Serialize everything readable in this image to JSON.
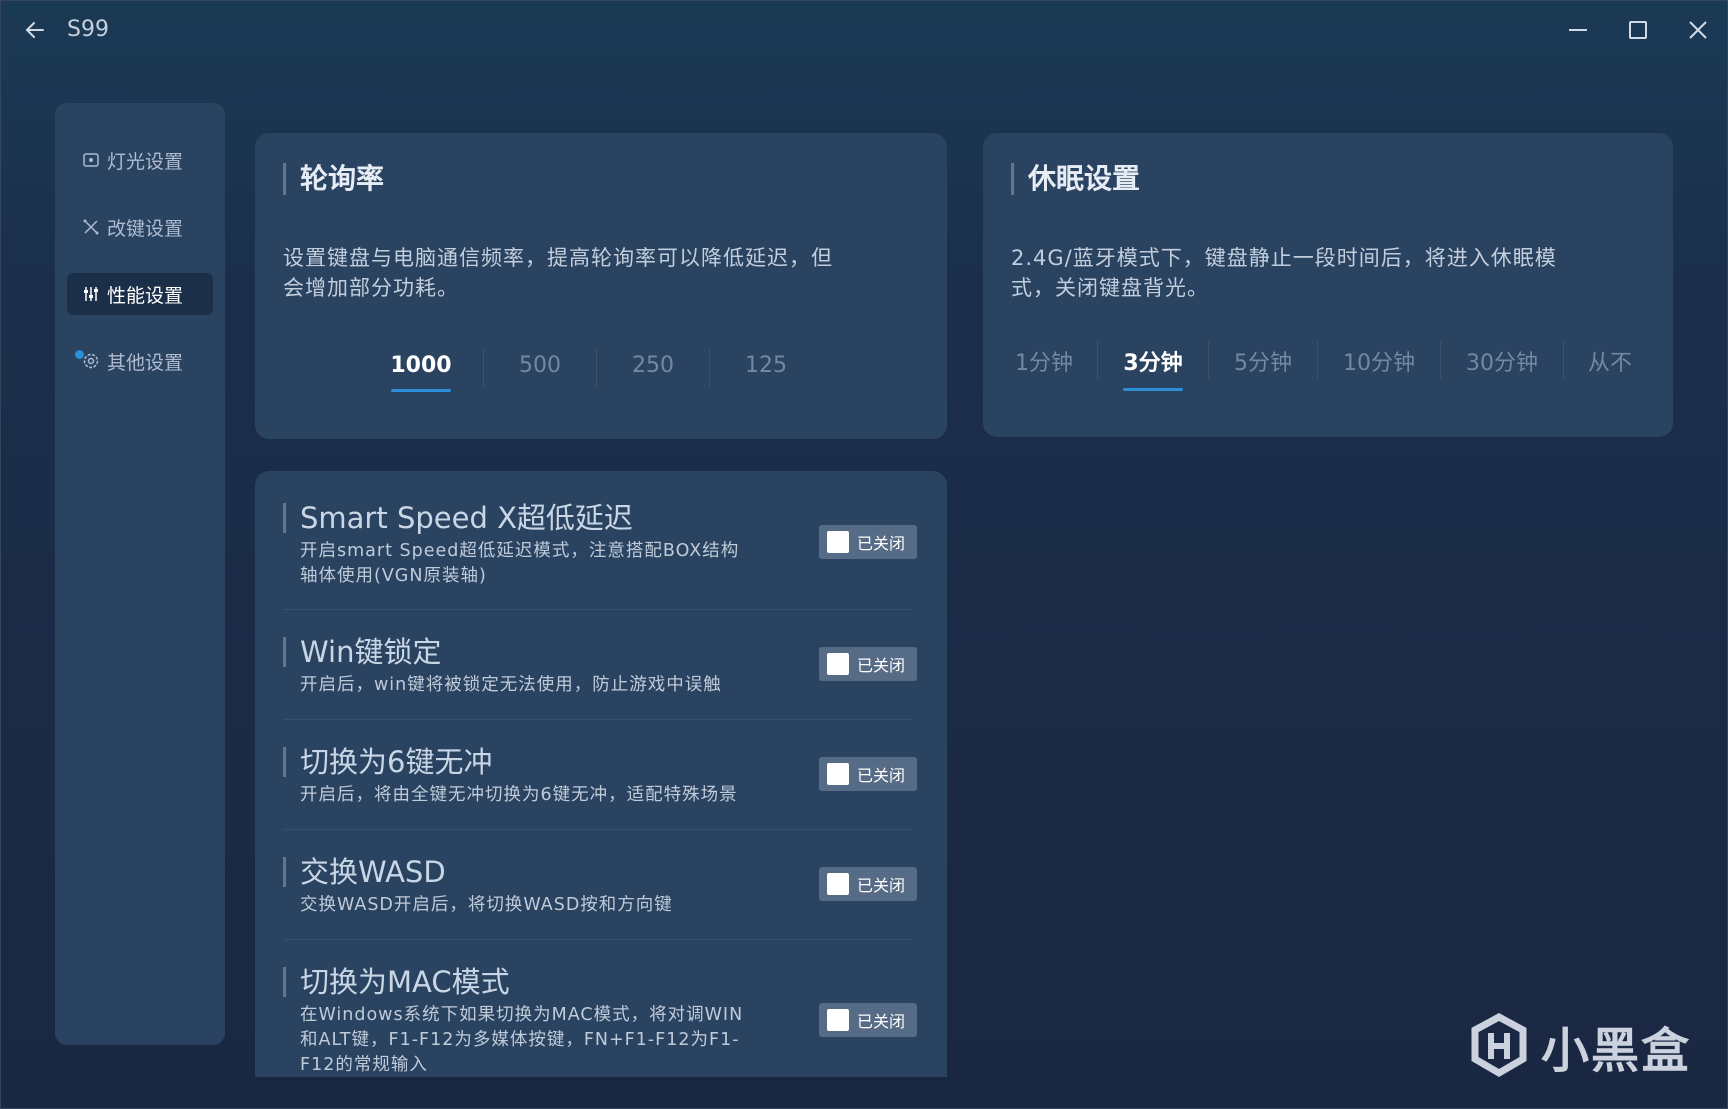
{
  "window": {
    "title": "S99"
  },
  "sidebar": {
    "items": [
      {
        "label": "灯光设置",
        "icon": "light-icon"
      },
      {
        "label": "改键设置",
        "icon": "keymap-icon"
      },
      {
        "label": "性能设置",
        "icon": "sliders-icon",
        "active": true
      },
      {
        "label": "其他设置",
        "icon": "gear-icon"
      }
    ]
  },
  "polling": {
    "title": "轮询率",
    "desc_line1": "设置键盘与电脑通信频率，提高轮询率可以降低延迟，但",
    "desc_line2": "会增加部分功耗。",
    "options": [
      "1000",
      "500",
      "250",
      "125"
    ],
    "selected": "1000"
  },
  "sleep": {
    "title": "休眠设置",
    "desc_line1": "2.4G/蓝牙模式下，键盘静止一段时间后，将进入休眠模",
    "desc_line2": "式，关闭键盘背光。",
    "options": [
      "1分钟",
      "3分钟",
      "5分钟",
      "10分钟",
      "30分钟",
      "从不"
    ],
    "selected": "3分钟"
  },
  "settings": [
    {
      "title": "Smart Speed X超低延迟",
      "desc_line1": "开启smart Speed超低延迟模式，注意搭配BOX结构",
      "desc_line2": "轴体使用(VGN原装轴)",
      "desc_line3": "",
      "state": "已关闭"
    },
    {
      "title": "Win键锁定",
      "desc_line1": "开启后，win键将被锁定无法使用，防止游戏中误触",
      "desc_line2": "",
      "desc_line3": "",
      "state": "已关闭"
    },
    {
      "title": "切换为6键无冲",
      "desc_line1": "开启后，将由全键无冲切换为6键无冲，适配特殊场景",
      "desc_line2": "",
      "desc_line3": "",
      "state": "已关闭"
    },
    {
      "title": "交换WASD",
      "desc_line1": "交换WASD开启后，将切换WASD按和方向键",
      "desc_line2": "",
      "desc_line3": "",
      "state": "已关闭"
    },
    {
      "title": "切换为MAC模式",
      "desc_line1": "在Windows系统下如果切换为MAC模式，将对调WIN",
      "desc_line2": "和ALT键，F1-F12为多媒体按键，FN+F1-F12为F1-",
      "desc_line3": "F12的常规输入",
      "state": "已关闭"
    }
  ],
  "watermark": {
    "text": "小黑盒"
  },
  "colors": {
    "accent": "#2b8fd8",
    "card": "#2a4361",
    "toggle_off": "#566b85"
  }
}
